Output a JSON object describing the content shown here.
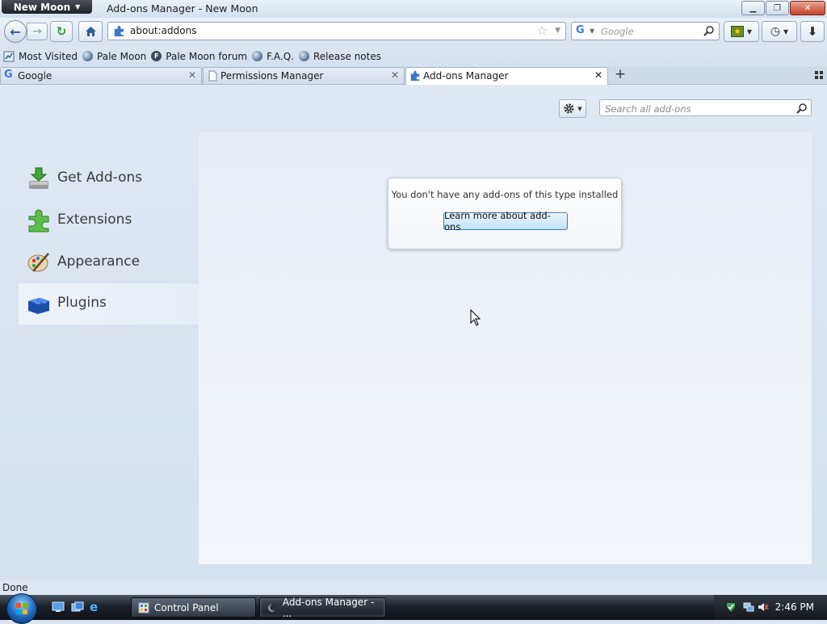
{
  "window": {
    "app_menu_label": "New Moon",
    "title": "Add-ons Manager - New Moon"
  },
  "navigation": {
    "url": "about:addons",
    "search_placeholder": "Google"
  },
  "bookmarks": [
    {
      "label": "Most Visited"
    },
    {
      "label": "Pale Moon"
    },
    {
      "label": "Pale Moon forum"
    },
    {
      "label": "F.A.Q."
    },
    {
      "label": "Release notes"
    }
  ],
  "tabs": [
    {
      "label": "Google",
      "active": false
    },
    {
      "label": "Permissions Manager",
      "active": false
    },
    {
      "label": "Add-ons Manager",
      "active": true
    }
  ],
  "addons": {
    "search_placeholder": "Search all add-ons",
    "categories": [
      {
        "label": "Get Add-ons",
        "icon": "get-addons-icon",
        "selected": false
      },
      {
        "label": "Extensions",
        "icon": "puzzle-icon",
        "selected": false
      },
      {
        "label": "Appearance",
        "icon": "palette-icon",
        "selected": false
      },
      {
        "label": "Plugins",
        "icon": "lego-brick-icon",
        "selected": true
      }
    ],
    "empty_message": "You don't have any add-ons of this type installed",
    "learn_more_label": "Learn more about add-ons"
  },
  "status": {
    "text": "Done"
  },
  "taskbar": {
    "tasks": [
      {
        "label": "Control Panel",
        "active": false
      },
      {
        "label": "Add-ons Manager - ...",
        "active": true
      }
    ],
    "clock": "2:46 PM"
  },
  "colors": {
    "accent": "#3c7fb1",
    "selected_category": "#e6eef7",
    "taskbar": "#1c222b"
  }
}
